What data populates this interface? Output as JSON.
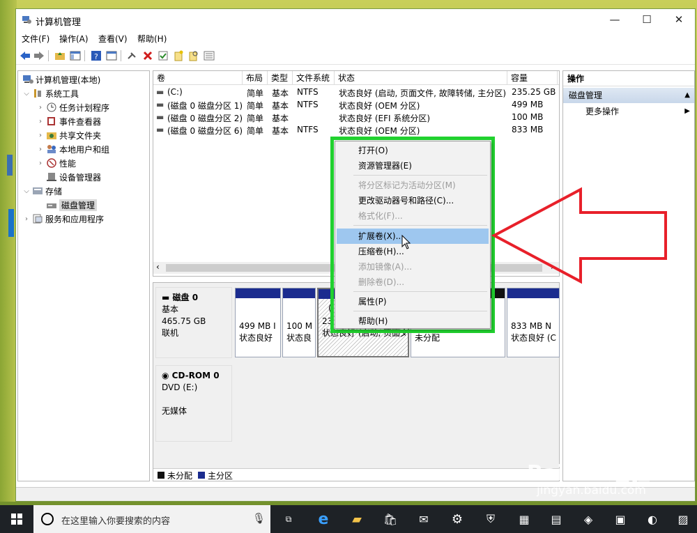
{
  "window": {
    "title": "计算机管理",
    "controls": {
      "minimize": "—",
      "maximize": "☐",
      "close": "✕"
    }
  },
  "menu": [
    "文件(F)",
    "操作(A)",
    "查看(V)",
    "帮助(H)"
  ],
  "tree": {
    "root": "计算机管理(本地)",
    "items": [
      {
        "label": "系统工具",
        "level": 1,
        "expanded": true
      },
      {
        "label": "任务计划程序",
        "level": 2
      },
      {
        "label": "事件查看器",
        "level": 2
      },
      {
        "label": "共享文件夹",
        "level": 2
      },
      {
        "label": "本地用户和组",
        "level": 2
      },
      {
        "label": "性能",
        "level": 2
      },
      {
        "label": "设备管理器",
        "level": 2
      },
      {
        "label": "存储",
        "level": 1,
        "expanded": true
      },
      {
        "label": "磁盘管理",
        "level": 2,
        "selected": true
      },
      {
        "label": "服务和应用程序",
        "level": 1
      }
    ]
  },
  "volumes": {
    "columns": [
      "卷",
      "布局",
      "类型",
      "文件系统",
      "状态",
      "容量"
    ],
    "rows": [
      [
        "(C:)",
        "简单",
        "基本",
        "NTFS",
        "状态良好 (启动, 页面文件, 故障转储, 主分区)",
        "235.25 GB"
      ],
      [
        "(磁盘 0 磁盘分区 1)",
        "简单",
        "基本",
        "NTFS",
        "状态良好 (OEM 分区)",
        "499 MB"
      ],
      [
        "(磁盘 0 磁盘分区 2)",
        "简单",
        "基本",
        "",
        "状态良好 (EFI 系统分区)",
        "100 MB"
      ],
      [
        "(磁盘 0 磁盘分区 6)",
        "简单",
        "基本",
        "NTFS",
        "状态良好 (OEM 分区)",
        "833 MB"
      ]
    ]
  },
  "disks": {
    "disk0": {
      "name": "磁盘 0",
      "type": "基本",
      "size": "465.75 GB",
      "status": "联机"
    },
    "partitions": [
      {
        "l1": "499 MB I",
        "l2": "状态良好"
      },
      {
        "l1": "100 M",
        "l2": "状态良"
      },
      {
        "l0": "(",
        "l1": "23",
        "l2": "状态良好 (启动, 页面文"
      },
      {
        "l2": "未分配"
      },
      {
        "l1": "833 MB N",
        "l2": "状态良好 (C"
      }
    ],
    "cdrom": {
      "name": "CD-ROM 0",
      "drive": "DVD (E:)",
      "media": "无媒体"
    },
    "legend": [
      "未分配",
      "主分区"
    ]
  },
  "actions": {
    "title": "操作",
    "section": "磁盘管理",
    "more": "更多操作"
  },
  "context_menu": [
    {
      "label": "打开(O)",
      "enabled": true
    },
    {
      "label": "资源管理器(E)",
      "enabled": true
    },
    {
      "sep": true
    },
    {
      "label": "将分区标记为活动分区(M)",
      "enabled": false
    },
    {
      "label": "更改驱动器号和路径(C)...",
      "enabled": true
    },
    {
      "label": "格式化(F)...",
      "enabled": false
    },
    {
      "sep": true
    },
    {
      "label": "扩展卷(X)...",
      "enabled": true,
      "highlighted": true
    },
    {
      "label": "压缩卷(H)...",
      "enabled": true
    },
    {
      "label": "添加镜像(A)...",
      "enabled": false
    },
    {
      "label": "删除卷(D)...",
      "enabled": false
    },
    {
      "sep": true
    },
    {
      "label": "属性(P)",
      "enabled": true
    },
    {
      "sep": true
    },
    {
      "label": "帮助(H)",
      "enabled": true
    }
  ],
  "taskbar": {
    "search_placeholder": "在这里输入你要搜索的内容"
  },
  "colors": {
    "highlight_frame": "#21d12f",
    "arrow": "#e8202a",
    "primary_partition": "#1b2c8f"
  },
  "watermark": {
    "brand": "Bai du 经验",
    "url": "jingyan.baidu.com"
  }
}
